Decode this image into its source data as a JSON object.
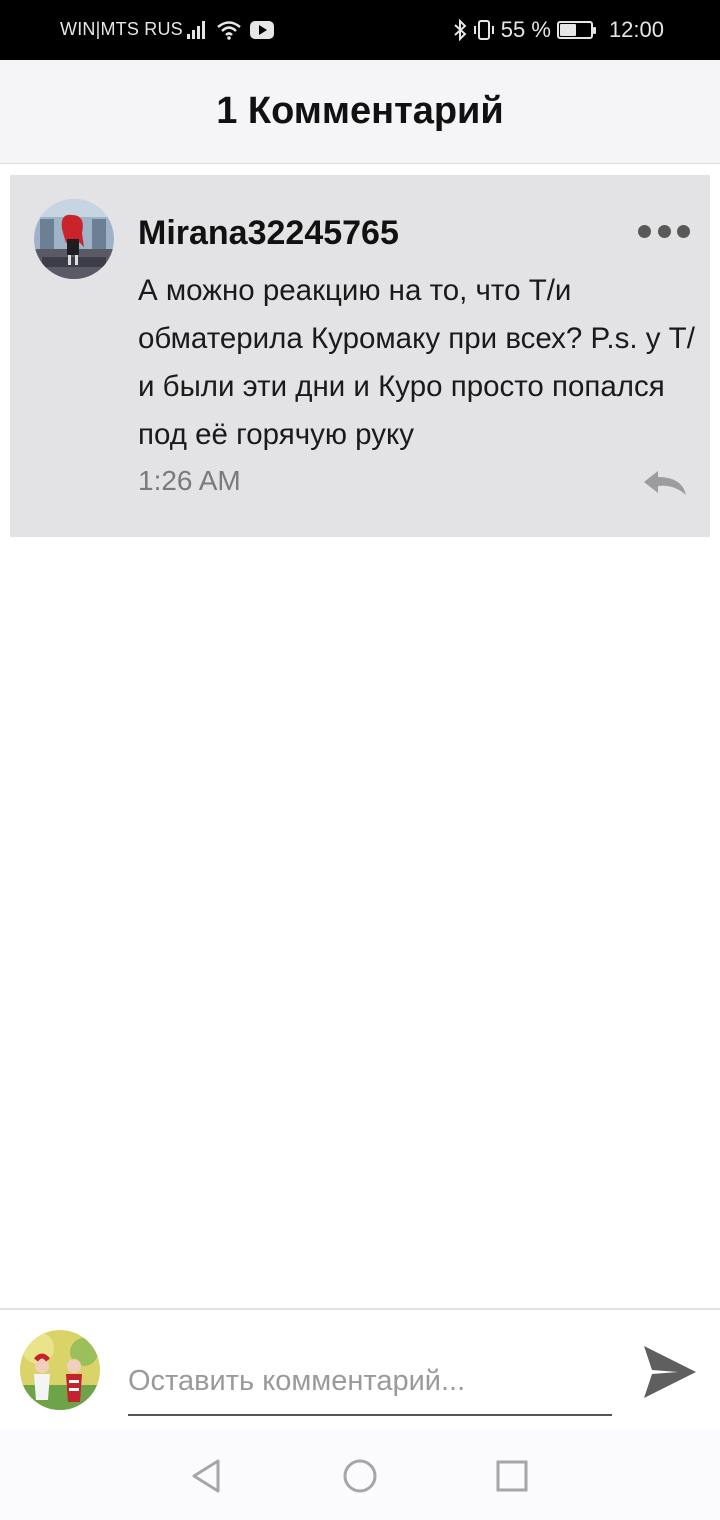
{
  "status_bar": {
    "carrier": "WIN|MTS RUS",
    "battery": "55 %",
    "time": "12:00",
    "icons": [
      "signal-icon",
      "wifi-icon",
      "youtube-icon",
      "bluetooth-icon",
      "vibrate-icon",
      "battery-icon"
    ]
  },
  "header": {
    "title": "1 Комментарий"
  },
  "comments": [
    {
      "username": "Mirana32245765",
      "text": "А можно реакцию на то, что Т/и обматерила Куромаку при всех? P.s. у Т/и были эти дни и Куро просто попался под её горячую руку",
      "time": "1:26 AM"
    }
  ],
  "input": {
    "placeholder": "Оставить комментарий...",
    "value": ""
  },
  "colors": {
    "card_bg": "#e3e2e4",
    "header_bg": "#f5f5f7",
    "icon_gray": "#595959"
  }
}
